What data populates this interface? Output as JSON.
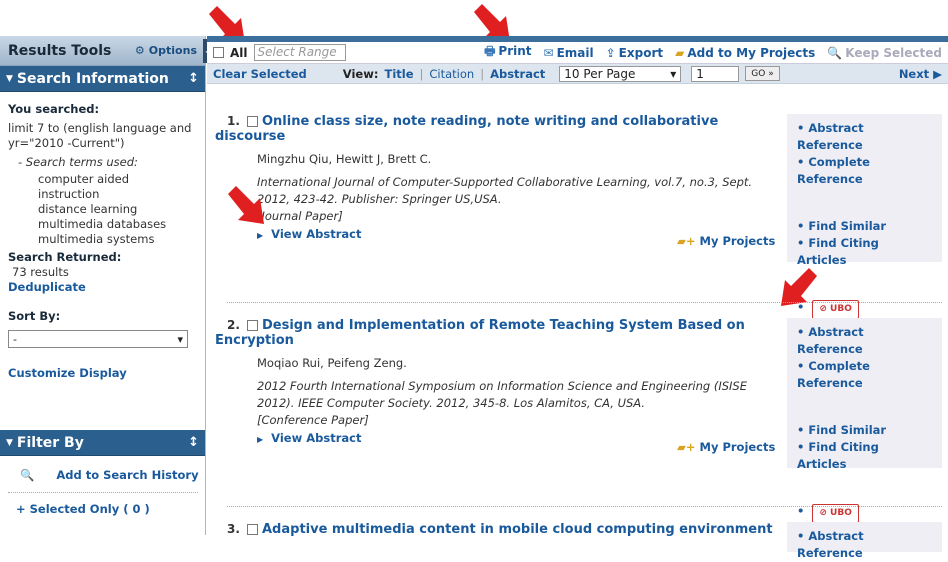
{
  "sidebar": {
    "title": "Results Tools",
    "options_label": "Options",
    "search_info_title": "Search Information",
    "you_searched_label": "You searched:",
    "query": "limit 7 to (english language and yr=\"2010 -Current\")",
    "terms_label": "- Search terms used:",
    "terms": [
      "computer aided",
      "instruction",
      "distance learning",
      "multimedia databases",
      "multimedia systems"
    ],
    "search_returned_label": "Search Returned:",
    "results_count": "73 results",
    "deduplicate": "Deduplicate",
    "sort_by_label": "Sort By:",
    "sort_value": "-",
    "customize_display": "Customize Display",
    "filter_by_title": "Filter By",
    "add_history": "Add to Search History",
    "selected_only": "+ Selected Only ( 0 )"
  },
  "toolbar": {
    "all_label": "All",
    "range_placeholder": "Select Range",
    "print": "Print",
    "email": "Email",
    "export": "Export",
    "add_projects": "Add to My Projects",
    "keep_selected": "Keep Selected"
  },
  "viewbar": {
    "clear_selected": "Clear Selected",
    "view_label": "View:",
    "title": "Title",
    "citation": "Citation",
    "abstract": "Abstract",
    "per_page": "10 Per Page",
    "page_num": "1",
    "go": "GO »",
    "next": "Next ▶"
  },
  "results": [
    {
      "num": "1.",
      "title": "Online class size, note reading, note writing and collaborative discourse",
      "authors": "Mingzhu Qiu, Hewitt J, Brett C.",
      "source": "International Journal of Computer-Supported Collaborative Learning, vol.7, no.3, Sept. 2012, 423-42. Publisher: Springer US,USA.",
      "type": "[Journal Paper]",
      "view_abstract": "View Abstract",
      "my_projects": "My Projects",
      "links": [
        "Abstract Reference",
        "Complete Reference",
        "Find Similar",
        "Find Citing Articles"
      ],
      "ubo": "UBO"
    },
    {
      "num": "2.",
      "title": "Design and Implementation of Remote Teaching System Based on Encryption",
      "authors": "Moqiao Rui, Peifeng Zeng.",
      "source": "2012 Fourth International Symposium on Information Science and Engineering (ISISE 2012). IEEE Computer Society. 2012, 345-8. Los Alamitos, CA, USA.",
      "type": "[Conference Paper]",
      "view_abstract": "View Abstract",
      "my_projects": "My Projects",
      "links": [
        "Abstract Reference",
        "Complete Reference",
        "Find Similar",
        "Find Citing Articles"
      ],
      "ubo": "UBO"
    },
    {
      "num": "3.",
      "title": "Adaptive multimedia content in mobile cloud computing environment",
      "links": [
        "Abstract Reference"
      ]
    }
  ],
  "colors": {
    "accent": "#1a5a9c",
    "section": "#2b5f8e",
    "arrow": "#e02020"
  }
}
